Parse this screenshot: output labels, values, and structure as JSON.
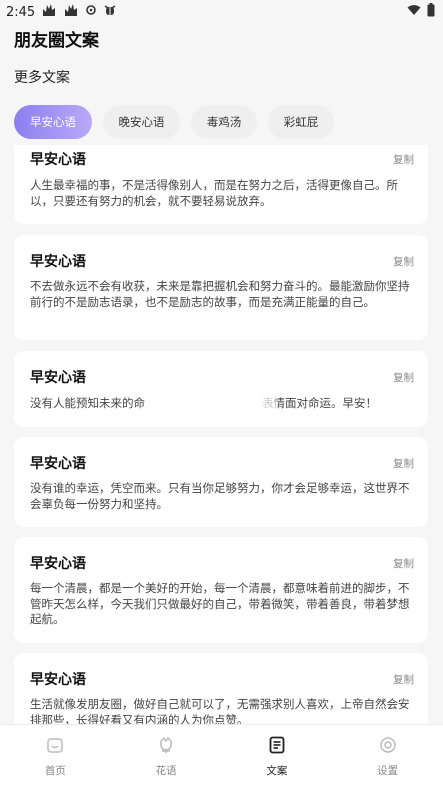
{
  "status_bar": {
    "time": "2:45"
  },
  "header": {
    "title": "朋友圈文案",
    "section_title": "更多文案"
  },
  "tabs": [
    {
      "label": "早安心语",
      "active": true
    },
    {
      "label": "晚安心语",
      "active": false
    },
    {
      "label": "毒鸡汤",
      "active": false
    },
    {
      "label": "彩虹屁",
      "active": false
    }
  ],
  "cards": [
    {
      "title": "早安心语",
      "copy_label": "复制",
      "text": "人生最幸福的事，不是活得像别人，而是在努力之后，活得更像自己。所以，只要还有努力的机会，就不要轻易说放弃。"
    },
    {
      "title": "早安心语",
      "copy_label": "复制",
      "text": "不去做永远不会有收获，未来是靠把握机会和努力奋斗的。最能激励你坚持前行的不是励志语录，也不是励志的故事，而是充满正能量的自己。"
    },
    {
      "title": "早安心语",
      "copy_label": "复制",
      "text_start": "没有人能预知未来的命",
      "text_end": "表情面对命运。早安！"
    },
    {
      "title": "早安心语",
      "copy_label": "复制",
      "text": "没有谁的幸运，凭空而来。只有当你足够努力，你才会足够幸运，这世界不会辜负每一份努力和坚持。"
    },
    {
      "title": "早安心语",
      "copy_label": "复制",
      "text": "每一个清晨，都是一个美好的开始，每一个清晨，都意味着前进的脚步，不管昨天怎么样，今天我们只做最好的自己，带着微笑，带着善良，带着梦想起航。"
    },
    {
      "title": "早安心语",
      "copy_label": "复制",
      "text": "生活就像发朋友圈，做好自己就可以了，无需强求别人喜欢，上帝自然会安排那些，长得好看又有内涵的人为你点赞。"
    }
  ],
  "bottom_nav": [
    {
      "label": "首页",
      "icon": "home-icon",
      "active": false
    },
    {
      "label": "花语",
      "icon": "flower-icon",
      "active": false
    },
    {
      "label": "文案",
      "icon": "document-icon",
      "active": true
    },
    {
      "label": "设置",
      "icon": "settings-icon",
      "active": false
    }
  ],
  "colors": {
    "accent_start": "#8e7ef0",
    "accent_end": "#b8aaf6",
    "background": "#f6f6f6",
    "card": "#ffffff"
  }
}
